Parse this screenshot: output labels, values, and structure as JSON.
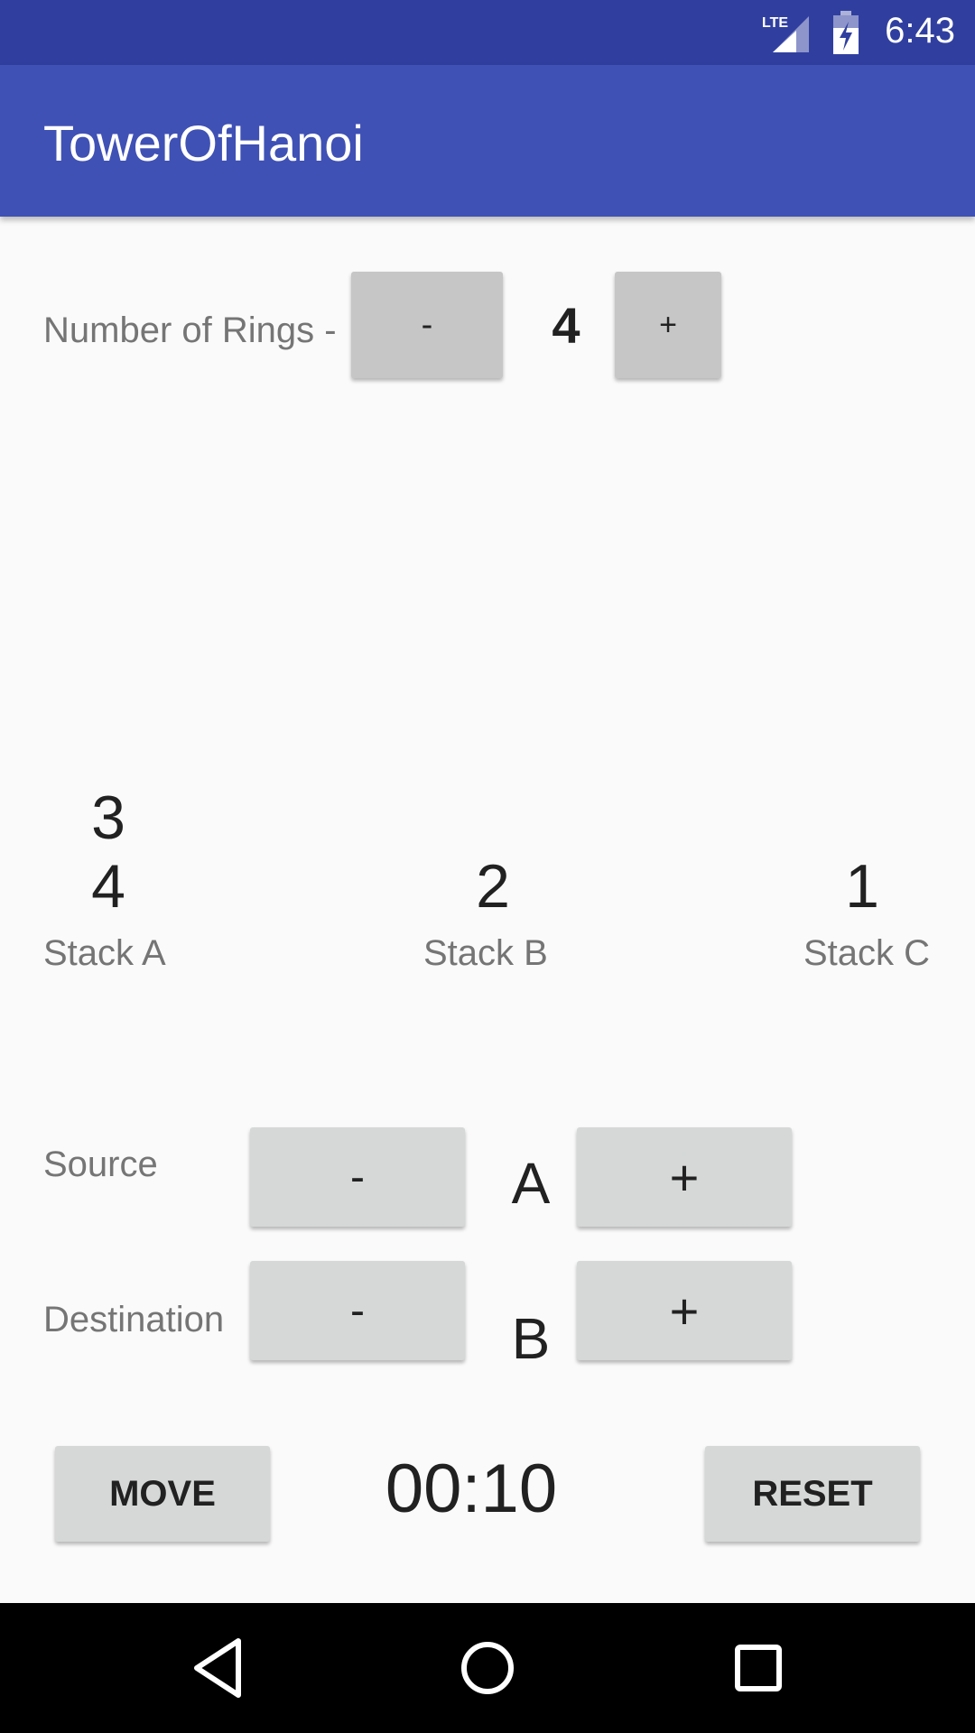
{
  "status_bar": {
    "time": "6:43",
    "network": "LTE"
  },
  "app_bar": {
    "title": "TowerOfHanoi"
  },
  "rings_control": {
    "label": "Number of Rings -",
    "decrement_label": "-",
    "value": "4",
    "increment_label": "+"
  },
  "stacks": [
    {
      "label": "Stack A",
      "rings": [
        "3",
        "4"
      ]
    },
    {
      "label": "Stack B",
      "rings": [
        "2"
      ]
    },
    {
      "label": "Stack C",
      "rings": [
        "1"
      ]
    }
  ],
  "source": {
    "label": "Source",
    "decrement_label": "-",
    "value": "A",
    "increment_label": "+"
  },
  "destination": {
    "label": "Destination",
    "decrement_label": "-",
    "value": "B",
    "increment_label": "+"
  },
  "actions": {
    "move_label": "MOVE",
    "timer": "00:10",
    "reset_label": "RESET"
  },
  "icons": {
    "lte": "lte-signal-icon",
    "battery": "battery-charging-icon",
    "back": "back-triangle-icon",
    "home": "home-circle-icon",
    "recents": "recents-square-icon"
  },
  "colors": {
    "status_bar": "#303f9f",
    "app_bar": "#3f51b5",
    "background": "#fafafa"
  }
}
